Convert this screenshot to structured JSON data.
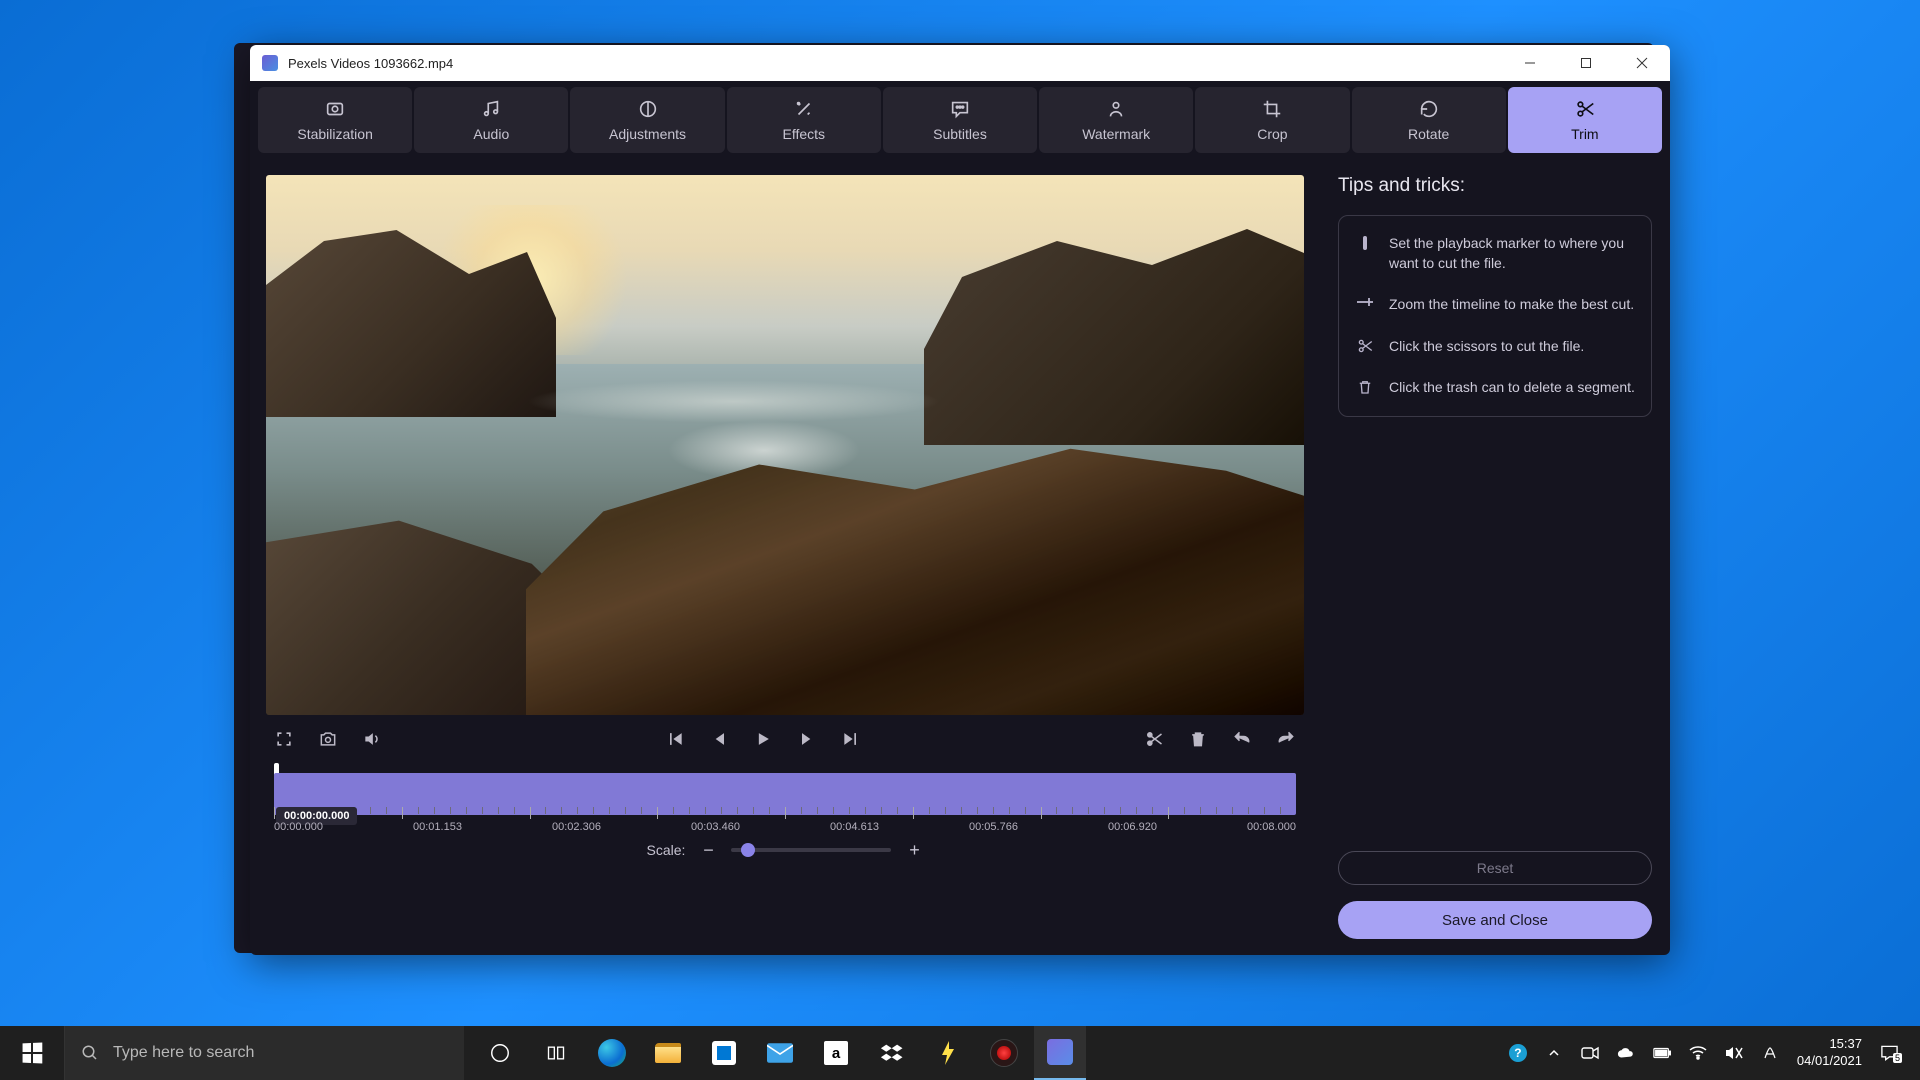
{
  "window": {
    "title": "Pexels Videos 1093662.mp4"
  },
  "toolbar": {
    "tabs": [
      {
        "label": "Stabilization"
      },
      {
        "label": "Audio"
      },
      {
        "label": "Adjustments"
      },
      {
        "label": "Effects"
      },
      {
        "label": "Subtitles"
      },
      {
        "label": "Watermark"
      },
      {
        "label": "Crop"
      },
      {
        "label": "Rotate"
      },
      {
        "label": "Trim"
      }
    ],
    "active_index": 8
  },
  "tips": {
    "heading": "Tips and tricks:",
    "items": [
      "Set the playback marker to where you want to cut the file.",
      "Zoom the timeline to make the best cut.",
      "Click the scissors to cut the file.",
      "Click the trash can to delete a segment."
    ]
  },
  "timeline": {
    "current": "00:00:00.000",
    "labels": [
      "00:00.000",
      "00:01.153",
      "00:02.306",
      "00:03.460",
      "00:04.613",
      "00:05.766",
      "00:06.920",
      "00:08.000"
    ]
  },
  "scale": {
    "label": "Scale:"
  },
  "buttons": {
    "reset": "Reset",
    "save": "Save and Close"
  },
  "taskbar": {
    "search_placeholder": "Type here to search",
    "time": "15:37",
    "date": "04/01/2021",
    "notif_count": "5"
  }
}
